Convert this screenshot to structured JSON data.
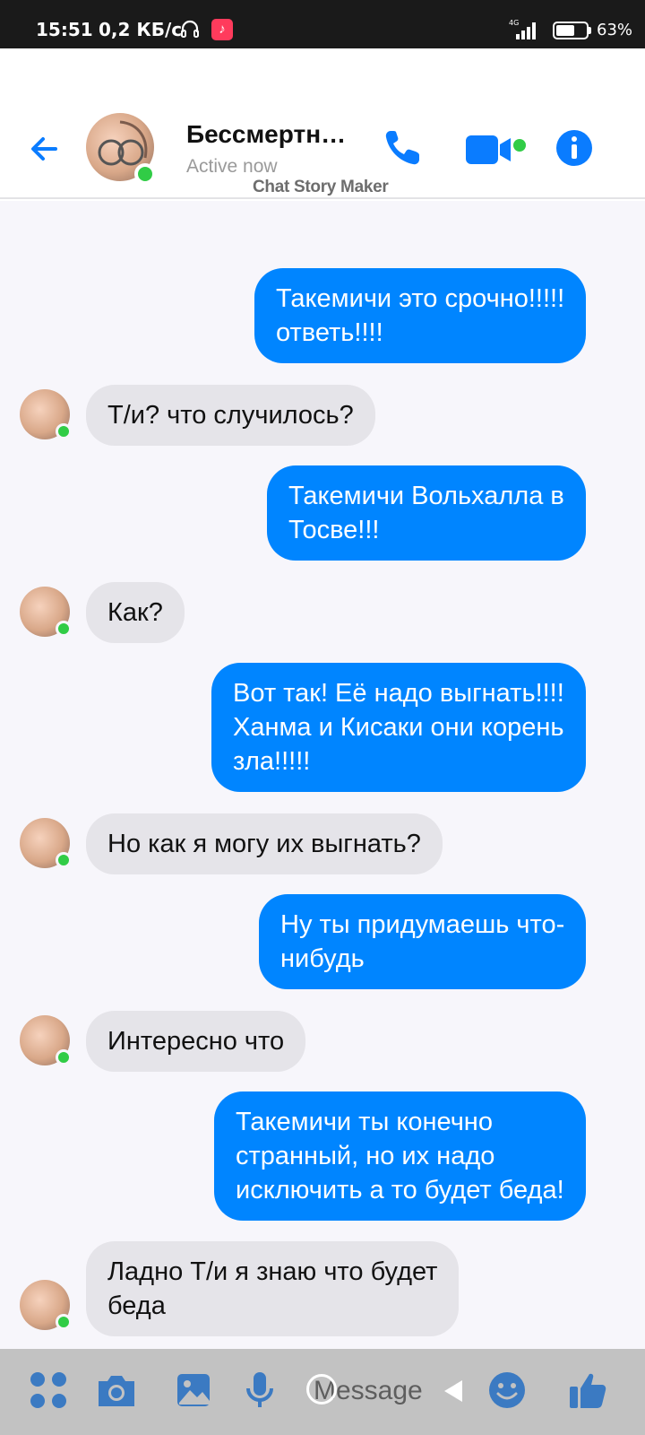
{
  "status_bar": {
    "time": "15:51",
    "speed": "0,2 КБ/с",
    "network": "4G",
    "battery_pct": "63%",
    "battery_level": 0.63
  },
  "header": {
    "contact_name": "Бессмертн…",
    "status": "Active now",
    "watermark": "Chat Story Maker",
    "accent_color": "#0084ff",
    "online_color": "#31cc46"
  },
  "messages": [
    {
      "dir": "out",
      "text": "Такемичи это срочно!!!!!\nответь!!!!"
    },
    {
      "dir": "in",
      "text": "Т/и? что случилось?"
    },
    {
      "dir": "out",
      "text": "Такемичи Вольхалла в\nТосве!!!"
    },
    {
      "dir": "in",
      "text": "Как?"
    },
    {
      "dir": "out",
      "text": "Вот так! Её надо выгнать!!!!\nХанма и Кисаки они корень\nзла!!!!!"
    },
    {
      "dir": "in",
      "text": "Но как я могу  их выгнать?"
    },
    {
      "dir": "out",
      "text": "Ну ты придумаешь что-\nнибудь"
    },
    {
      "dir": "in",
      "text": "Интересно что"
    },
    {
      "dir": "out",
      "text": "Такемичи ты конечно\nстранный, но их надо\nисключить а то будет беда!"
    },
    {
      "dir": "in",
      "text": "Ладно Т/и я знаю что будет\nбеда"
    }
  ],
  "composer": {
    "placeholder": "Message"
  },
  "icons": {
    "back": "arrow-left-icon",
    "call": "phone-icon",
    "video": "video-camera-icon",
    "info": "info-icon",
    "apps": "four-dots-icon",
    "camera": "camera-icon",
    "gallery": "image-icon",
    "mic": "microphone-icon",
    "emoji": "smiley-icon",
    "like": "thumbs-up-icon"
  }
}
